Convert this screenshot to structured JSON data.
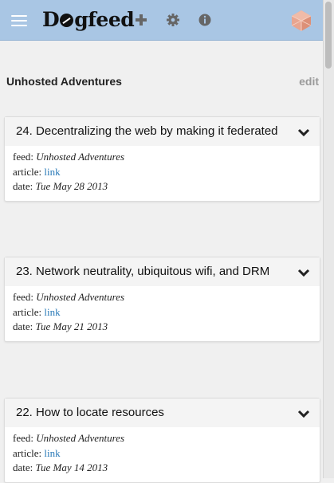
{
  "app": {
    "logo_before": "D",
    "logo_after": "gfeed"
  },
  "header_icons": [
    "menu-icon",
    "plus-icon",
    "gear-icon",
    "info-icon",
    "avatar-cube-icon"
  ],
  "feed": {
    "title": "Unhosted Adventures",
    "edit_label": "edit"
  },
  "labels": {
    "feed": "feed:",
    "article": "article:",
    "date": "date:"
  },
  "articles": [
    {
      "title": "24. Decentralizing the web by making it federated",
      "feed": "Unhosted Adventures",
      "link": "link",
      "date": "Tue May 28 2013"
    },
    {
      "title": "23. Network neutrality, ubiquitous wifi, and DRM",
      "feed": "Unhosted Adventures",
      "link": "link",
      "date": "Tue May 21 2013"
    },
    {
      "title": "22. How to locate resources",
      "feed": "Unhosted Adventures",
      "link": "link",
      "date": "Tue May 14 2013"
    }
  ],
  "colors": {
    "topbar": "#a9c6e4",
    "link": "#2a7ab8",
    "edit": "#9a9a9a",
    "avatar": "#e8a590"
  }
}
